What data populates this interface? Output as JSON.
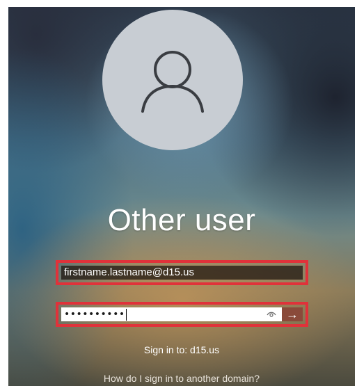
{
  "account": {
    "name": "Other user",
    "avatar_icon": "person-icon"
  },
  "form": {
    "username_value": "firstname.lastname@d15.us",
    "password_masked": "••••••••••",
    "reveal_icon": "eye-icon",
    "submit_icon": "arrow-right-icon",
    "submit_glyph": "→"
  },
  "footer": {
    "sign_in_to": "Sign in to: d15.us",
    "other_domain_link": "How do I sign in to another domain?"
  },
  "colors": {
    "highlight_border": "#e0323a",
    "submit_button": "#8a4a3a"
  }
}
